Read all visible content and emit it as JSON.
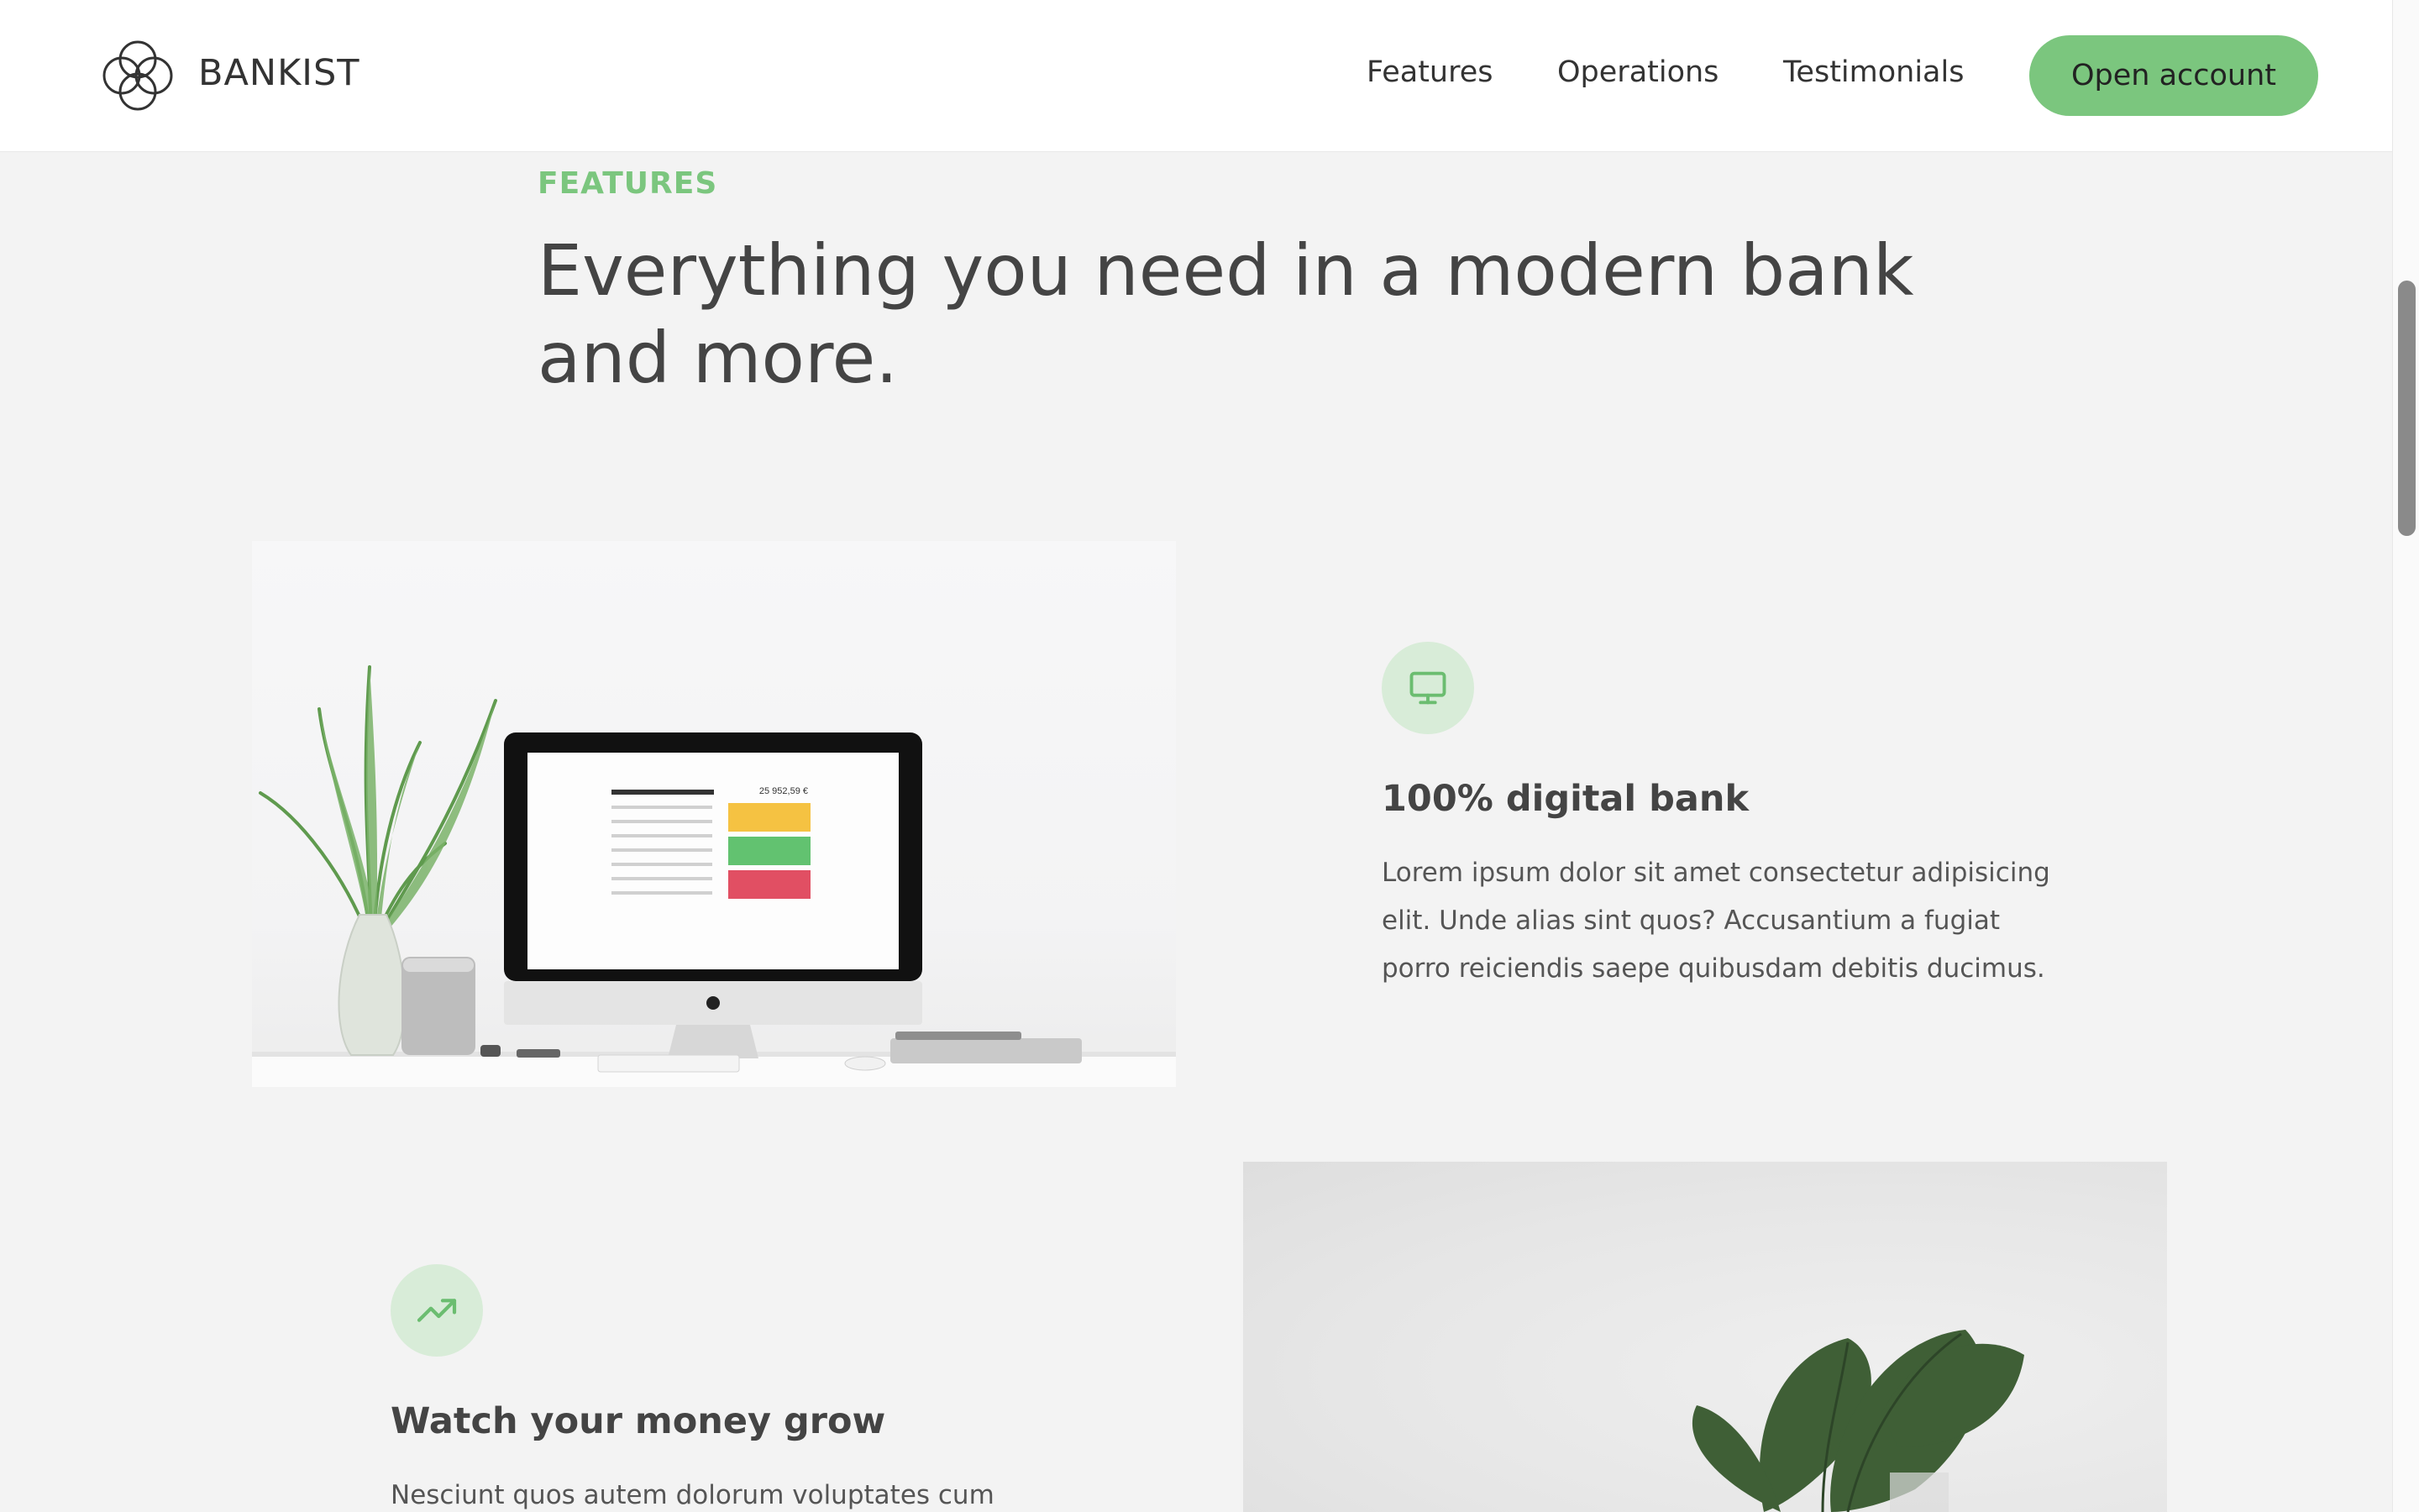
{
  "nav": {
    "brand": "BANKIST",
    "links": [
      "Features",
      "Operations",
      "Testimonials"
    ],
    "cta": "Open account"
  },
  "section": {
    "label": "FEATURES",
    "title": "Everything you need in a modern bank and more."
  },
  "features": [
    {
      "icon": "monitor-icon",
      "title": "100% digital bank",
      "text": "Lorem ipsum dolor sit amet consectetur adipisicing elit. Unde alias sint quos? Accusantium a fugiat porro reiciendis saepe quibusdam debitis ducimus."
    },
    {
      "icon": "trending-up-icon",
      "title": "Watch your money grow",
      "text": "Nesciunt quos autem dolorum voluptates cum"
    }
  ],
  "screen": {
    "balance": "25 952,59 €"
  },
  "colors": {
    "accent": "#7bc67e",
    "icon_bg": "#d8ecd8",
    "page_bg": "#f3f3f3",
    "heading": "#444444"
  }
}
